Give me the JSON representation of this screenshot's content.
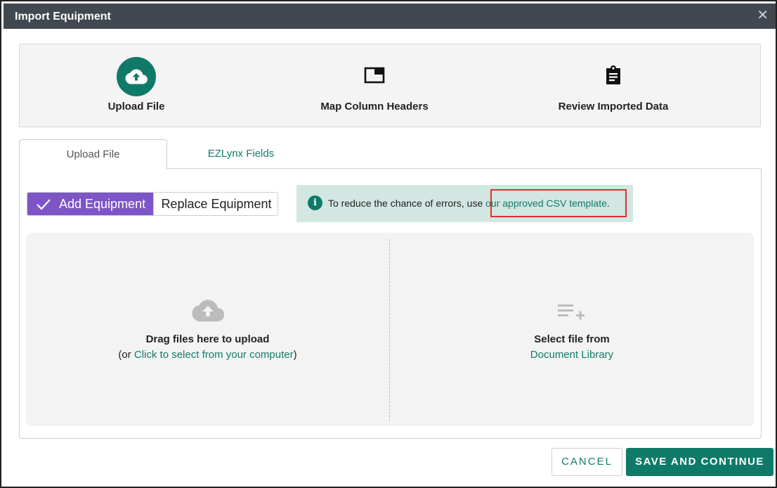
{
  "modal": {
    "title": "Import Equipment",
    "close_icon": "close-icon"
  },
  "stepper": {
    "steps": [
      {
        "label": "Upload File",
        "icon": "cloud-upload-icon",
        "active": true
      },
      {
        "label": "Map Column Headers",
        "icon": "window-icon",
        "active": false
      },
      {
        "label": "Review Imported Data",
        "icon": "clipboard-icon",
        "active": false
      }
    ]
  },
  "tabs": [
    {
      "label": "Upload File",
      "selected": true
    },
    {
      "label": "EZLynx Fields",
      "selected": false
    }
  ],
  "mode_toggle": {
    "options": [
      {
        "label": "Add Equipment",
        "selected": true
      },
      {
        "label": "Replace Equipment",
        "selected": false
      }
    ]
  },
  "info_banner": {
    "icon": "info-icon",
    "text": "To reduce the chance of errors, use ",
    "link": "our approved CSV template",
    "suffix": "."
  },
  "dropzone": {
    "upload": {
      "icon": "cloud-upload-icon",
      "title": "Drag files here to upload",
      "prefix": "(or ",
      "link": "Click to select from your computer",
      "suffix": ")"
    },
    "library": {
      "icon": "playlist-add-icon",
      "title": "Select file from",
      "link": "Document Library"
    }
  },
  "footer": {
    "cancel_label": "CANCEL",
    "save_label": "SAVE AND CONTINUE"
  },
  "colors": {
    "accent": "#0f7a68",
    "toggle_selected": "#7d55c7",
    "titlebar": "#414850",
    "info_bg": "#d2e6e2",
    "highlight": "#e0312c"
  }
}
